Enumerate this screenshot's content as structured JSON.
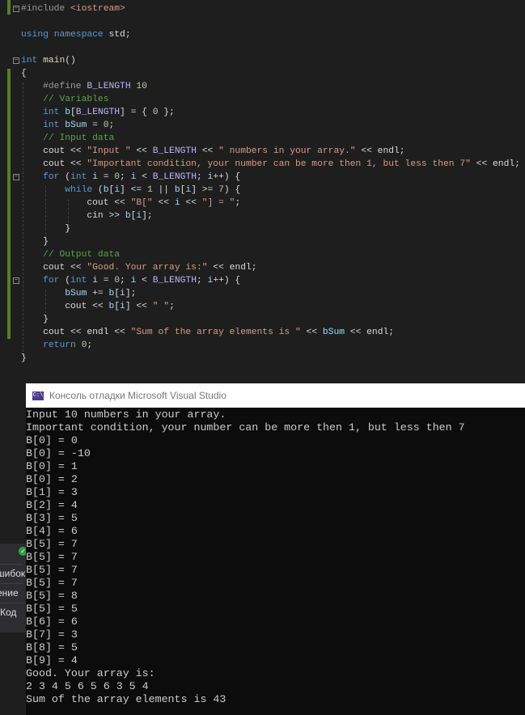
{
  "editor": {
    "lines": [
      [
        [
          "#include ",
          "t-pp"
        ],
        [
          "<iostream>",
          "t-st"
        ]
      ],
      [],
      [
        [
          "using ",
          "t-kw"
        ],
        [
          "namespace ",
          "t-kw"
        ],
        [
          "std;",
          ""
        ]
      ],
      [],
      [
        [
          "int ",
          "t-kw"
        ],
        [
          "main",
          "t-fn"
        ],
        [
          "()",
          ""
        ]
      ],
      [
        [
          "{",
          ""
        ]
      ],
      [
        [
          "    #define ",
          "t-pp"
        ],
        [
          "B_LENGTH ",
          "t-mc"
        ],
        [
          "10",
          "t-num"
        ]
      ],
      [
        [
          "    // Variables",
          "t-cm"
        ]
      ],
      [
        [
          "    int ",
          "t-kw"
        ],
        [
          "b",
          "t-var"
        ],
        [
          "[",
          ""
        ],
        [
          "B_LENGTH",
          "t-mc"
        ],
        [
          "] = { ",
          ""
        ],
        [
          "0",
          "t-num"
        ],
        [
          " };",
          ""
        ]
      ],
      [
        [
          "    int ",
          "t-kw"
        ],
        [
          "bSum",
          "t-var"
        ],
        [
          " = ",
          ""
        ],
        [
          "0",
          "t-num"
        ],
        [
          ";",
          ""
        ]
      ],
      [
        [
          "    // Input data",
          "t-cm"
        ]
      ],
      [
        [
          "    cout << ",
          ""
        ],
        [
          "\"Input \"",
          "t-st"
        ],
        [
          " << ",
          ""
        ],
        [
          "B_LENGTH",
          "t-mc"
        ],
        [
          " << ",
          ""
        ],
        [
          "\" numbers in your array.\"",
          "t-st"
        ],
        [
          " << endl;",
          ""
        ]
      ],
      [
        [
          "    cout << ",
          ""
        ],
        [
          "\"Important condition, your number can be more then 1, but less then 7\"",
          "t-st"
        ],
        [
          " << endl;",
          ""
        ]
      ],
      [
        [
          "    for ",
          "t-kw"
        ],
        [
          "(",
          ""
        ],
        [
          "int ",
          "t-kw"
        ],
        [
          "i",
          "t-var"
        ],
        [
          " = ",
          ""
        ],
        [
          "0",
          "t-num"
        ],
        [
          "; ",
          ""
        ],
        [
          "i",
          "t-var"
        ],
        [
          " < ",
          ""
        ],
        [
          "B_LENGTH",
          "t-mc"
        ],
        [
          "; ",
          ""
        ],
        [
          "i",
          "t-var"
        ],
        [
          "++) {",
          ""
        ]
      ],
      [
        [
          "        while ",
          "t-kw"
        ],
        [
          "(",
          ""
        ],
        [
          "b",
          "t-var"
        ],
        [
          "[",
          ""
        ],
        [
          "i",
          "t-var"
        ],
        [
          "] <= ",
          ""
        ],
        [
          "1",
          "t-num"
        ],
        [
          " || ",
          ""
        ],
        [
          "b",
          "t-var"
        ],
        [
          "[",
          ""
        ],
        [
          "i",
          "t-var"
        ],
        [
          "] >= ",
          ""
        ],
        [
          "7",
          "t-num"
        ],
        [
          ") {",
          ""
        ]
      ],
      [
        [
          "            cout << ",
          ""
        ],
        [
          "\"B[\"",
          "t-st"
        ],
        [
          " << ",
          ""
        ],
        [
          "i",
          "t-var"
        ],
        [
          " << ",
          ""
        ],
        [
          "\"] = \"",
          "t-st"
        ],
        [
          ";",
          ""
        ]
      ],
      [
        [
          "            cin >> ",
          ""
        ],
        [
          "b",
          "t-var"
        ],
        [
          "[",
          ""
        ],
        [
          "i",
          "t-var"
        ],
        [
          "];",
          ""
        ]
      ],
      [
        [
          "        }",
          ""
        ]
      ],
      [
        [
          "    }",
          ""
        ]
      ],
      [
        [
          "    // Output data",
          "t-cm"
        ]
      ],
      [
        [
          "    cout << ",
          ""
        ],
        [
          "\"Good. Your array is:\"",
          "t-st"
        ],
        [
          " << endl;",
          ""
        ]
      ],
      [
        [
          "    for ",
          "t-kw"
        ],
        [
          "(",
          ""
        ],
        [
          "int ",
          "t-kw"
        ],
        [
          "i",
          "t-var"
        ],
        [
          " = ",
          ""
        ],
        [
          "0",
          "t-num"
        ],
        [
          "; ",
          ""
        ],
        [
          "i",
          "t-var"
        ],
        [
          " < ",
          ""
        ],
        [
          "B_LENGTH",
          "t-mc"
        ],
        [
          "; ",
          ""
        ],
        [
          "i",
          "t-var"
        ],
        [
          "++) {",
          ""
        ]
      ],
      [
        [
          "        bSum",
          "t-var"
        ],
        [
          " += ",
          ""
        ],
        [
          "b",
          "t-var"
        ],
        [
          "[",
          ""
        ],
        [
          "i",
          "t-var"
        ],
        [
          "];",
          ""
        ]
      ],
      [
        [
          "        cout << ",
          ""
        ],
        [
          "b",
          "t-var"
        ],
        [
          "[",
          ""
        ],
        [
          "i",
          "t-var"
        ],
        [
          "] << ",
          ""
        ],
        [
          "\" \"",
          "t-st"
        ],
        [
          ";",
          ""
        ]
      ],
      [
        [
          "    }",
          ""
        ]
      ],
      [
        [
          "    cout << endl << ",
          ""
        ],
        [
          "\"Sum of the array elements is \"",
          "t-st"
        ],
        [
          " << ",
          ""
        ],
        [
          "bSum",
          "t-var"
        ],
        [
          " << endl;",
          ""
        ]
      ],
      [
        [
          "    return ",
          "t-kw"
        ],
        [
          "0",
          "t-num"
        ],
        [
          ";",
          ""
        ]
      ],
      [
        [
          "}",
          ""
        ]
      ]
    ]
  },
  "console": {
    "title": "Консоль отладки Microsoft Visual Studio",
    "icon_label": "C:\\",
    "output": [
      "Input 10 numbers in your array.",
      "Important condition, your number can be more then 1, but less then 7",
      "B[0] = 0",
      "B[0] = -10",
      "B[0] = 1",
      "B[0] = 2",
      "B[1] = 3",
      "B[2] = 4",
      "B[3] = 5",
      "B[4] = 6",
      "B[5] = 7",
      "B[5] = 7",
      "B[5] = 7",
      "B[5] = 7",
      "B[5] = 8",
      "B[5] = 5",
      "B[6] = 6",
      "B[7] = 3",
      "B[8] = 5",
      "B[9] = 4",
      "Good. Your array is:",
      "2 3 4 5 6 5 6 3 5 4",
      "Sum of the array elements is 43"
    ]
  },
  "side_panel": {
    "items": [
      "шибок",
      "ение",
      "Код"
    ],
    "status_icon": "check-icon"
  }
}
